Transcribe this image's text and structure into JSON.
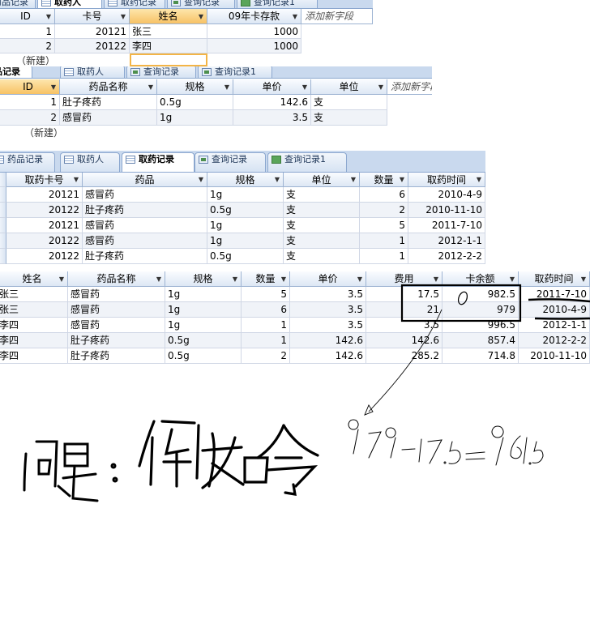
{
  "panel1": {
    "tabs": [
      {
        "label": "药品记录",
        "active": false,
        "icon": "table-icon"
      },
      {
        "label": "取药人",
        "active": true,
        "icon": "table-icon"
      },
      {
        "label": "取药记录",
        "active": false,
        "icon": "table-icon"
      },
      {
        "label": "查询记录",
        "active": false,
        "icon": "query-icon"
      },
      {
        "label": "查询记录1",
        "active": false,
        "icon": "query-icon"
      }
    ],
    "columns": [
      {
        "label": "ID"
      },
      {
        "label": "卡号"
      },
      {
        "label": "姓名"
      },
      {
        "label": "09年卡存款"
      },
      {
        "label": "添加新字段"
      }
    ],
    "rows": [
      [
        "1",
        "20121",
        "张三",
        "1000"
      ],
      [
        "2",
        "20122",
        "李四",
        "1000"
      ]
    ],
    "new_row": "（新建）"
  },
  "panel2": {
    "tabs": [
      {
        "label": "药品记录",
        "active": true,
        "icon": "table-icon"
      },
      {
        "label": "取药人",
        "active": false,
        "icon": "table-icon"
      },
      {
        "label": "查询记录",
        "active": false,
        "icon": "query-icon"
      },
      {
        "label": "查询记录1",
        "active": false,
        "icon": "query-icon"
      }
    ],
    "columns": [
      {
        "label": "ID"
      },
      {
        "label": "药品名称"
      },
      {
        "label": "规格"
      },
      {
        "label": "单价"
      },
      {
        "label": "单位"
      },
      {
        "label": "添加新字段"
      }
    ],
    "rows": [
      [
        "1",
        "肚子疼药",
        "0.5g",
        "142.6",
        "支"
      ],
      [
        "2",
        "感冒药",
        "1g",
        "3.5",
        "支"
      ]
    ],
    "new_row": "（新建）"
  },
  "panel3": {
    "tabs": [
      {
        "label": "药品记录",
        "active": false,
        "icon": "table-icon"
      },
      {
        "label": "取药人",
        "active": false,
        "icon": "table-icon"
      },
      {
        "label": "取药记录",
        "active": true,
        "icon": "table-icon"
      },
      {
        "label": "查询记录",
        "active": false,
        "icon": "query-icon"
      },
      {
        "label": "查询记录1",
        "active": false,
        "icon": "query-icon"
      }
    ],
    "columns": [
      {
        "label": "取药卡号"
      },
      {
        "label": "药品"
      },
      {
        "label": "规格"
      },
      {
        "label": "单位"
      },
      {
        "label": "数量"
      },
      {
        "label": "取药时间"
      }
    ],
    "rows": [
      [
        "20121",
        "感冒药",
        "1g",
        "支",
        "6",
        "2010-4-9"
      ],
      [
        "20122",
        "肚子疼药",
        "0.5g",
        "支",
        "2",
        "2010-11-10"
      ],
      [
        "20121",
        "感冒药",
        "1g",
        "支",
        "5",
        "2011-7-10"
      ],
      [
        "20122",
        "感冒药",
        "1g",
        "支",
        "1",
        "2012-1-1"
      ],
      [
        "20122",
        "肚子疼药",
        "0.5g",
        "支",
        "1",
        "2012-2-2"
      ]
    ]
  },
  "panel4": {
    "columns": [
      {
        "label": "姓名"
      },
      {
        "label": "药品名称"
      },
      {
        "label": "规格"
      },
      {
        "label": "数量"
      },
      {
        "label": "单价"
      },
      {
        "label": "费用"
      },
      {
        "label": "卡余额"
      },
      {
        "label": "取药时间"
      }
    ],
    "rows": [
      [
        "张三",
        "感冒药",
        "1g",
        "5",
        "3.5",
        "17.5",
        "982.5",
        "2011-7-10"
      ],
      [
        "张三",
        "感冒药",
        "1g",
        "6",
        "3.5",
        "21",
        "979",
        "2010-4-9"
      ],
      [
        "李四",
        "感冒药",
        "1g",
        "1",
        "3.5",
        "3.5",
        "996.5",
        "2012-1-1"
      ],
      [
        "李四",
        "肚子疼药",
        "0.5g",
        "1",
        "142.6",
        "142.6",
        "857.4",
        "2012-2-2"
      ],
      [
        "李四",
        "肚子疼药",
        "0.5g",
        "2",
        "142.6",
        "285.2",
        "714.8",
        "2010-11-10"
      ]
    ]
  },
  "handwriting": {
    "label": "问题:",
    "word": "倒如令",
    "equation": "979-17.5=961.5"
  },
  "colors": {
    "header_bg": "#dde7f4",
    "selected_header": "#f7c265",
    "tab_bar": "#c9d9ee",
    "grid_line": "#d0d7e5"
  }
}
